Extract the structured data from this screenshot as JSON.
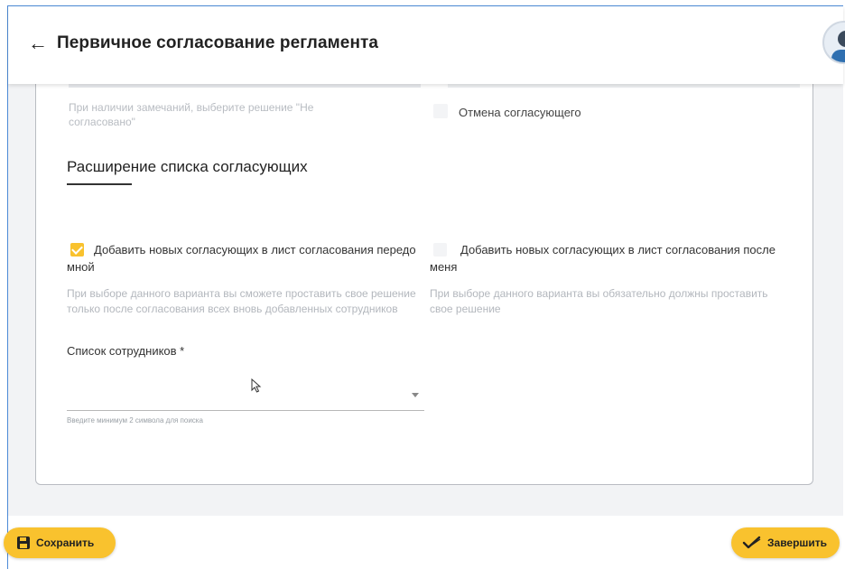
{
  "header": {
    "back_glyph": "←",
    "title": "Первичное согласование регламента"
  },
  "top_section": {
    "hint_left": "При наличии замечаний, выберите решение \"Не согласовано\"",
    "cancel_label": "Отмена согласующего"
  },
  "section": {
    "title": "Расширение списка согласующих"
  },
  "options": [
    {
      "label": "Добавить новых согласующих в лист согласования передо мной",
      "checked": true,
      "hint": "При выборе данного варианта вы сможете проставить свое решение только после согласования всех вновь добавленных сотрудников"
    },
    {
      "label": "Добавить новых согласующих в лист согласования после меня",
      "checked": false,
      "hint": "При выборе данного варианта вы обязательно должны проставить свое решение"
    }
  ],
  "employees_field": {
    "label": "Список сотрудников *",
    "value": "",
    "hint": "Введите минимум 2 символа для поиска"
  },
  "footer": {
    "save_label": "Сохранить",
    "finish_label": "Завершить"
  },
  "colors": {
    "accent": "#f9c22e",
    "frame_border": "#4c8ad6"
  },
  "icons": [
    "back-arrow-icon",
    "avatar",
    "checkbox-checked-icon",
    "checkbox-unchecked-icon",
    "dropdown-caret-icon",
    "mouse-cursor-icon",
    "floppy-disk-icon",
    "checkmark-pen-icon"
  ]
}
